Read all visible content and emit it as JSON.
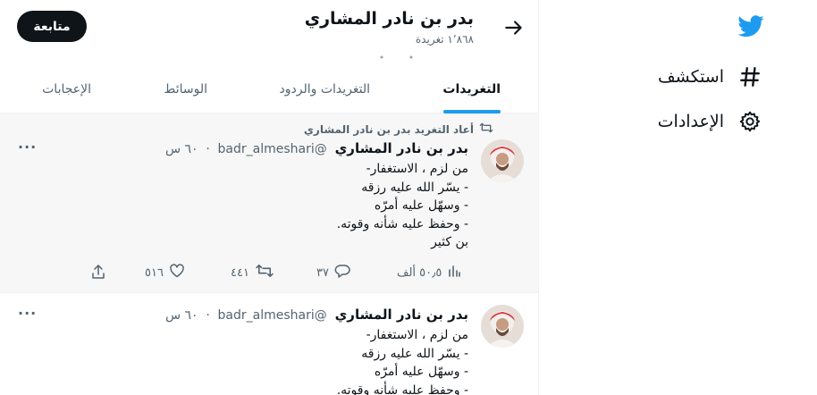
{
  "nav": {
    "explore_label": "استكشف",
    "settings_label": "الإعدادات"
  },
  "profile": {
    "name": "بدر بن نادر المشاري",
    "tweet_count": "١٬٨٦٨ تغريدة",
    "follow_label": "متابعة"
  },
  "tabs": [
    {
      "label": "التغريدات",
      "active": true
    },
    {
      "label": "التغريدات والردود",
      "active": false
    },
    {
      "label": "الوسائط",
      "active": false
    },
    {
      "label": "الإعجابات",
      "active": false
    }
  ],
  "tweets": [
    {
      "retweet_text": "أعاد التغريد بدر بن نادر المشاري",
      "author": "بدر بن نادر المشاري",
      "handle": "@badr_almeshari",
      "time": "٦٠ س",
      "lines": [
        "من لزم ، الاستغفار-",
        "- يسّر الله عليه رزقه",
        "- وسهّل عليه أمرّه",
        "- وحفظ عليه شأنه وقوته.",
        "بن كثير"
      ],
      "views": "٥٠٫٥ ألف",
      "replies": "٣٧",
      "retweets": "٤٤١",
      "likes": "٥١٦"
    },
    {
      "author": "بدر بن نادر المشاري",
      "handle": "@badr_almeshari",
      "time": "٦٠ س",
      "lines": [
        "من لزم ، الاستغفار-",
        "- يسّر الله عليه رزقه",
        "- وسهّل عليه أمرّه",
        "- وحفظ عليه شأنه وقوته."
      ]
    }
  ],
  "colors": {
    "accent": "#1d9bf0",
    "text_primary": "#0f1419",
    "text_secondary": "#536471"
  }
}
